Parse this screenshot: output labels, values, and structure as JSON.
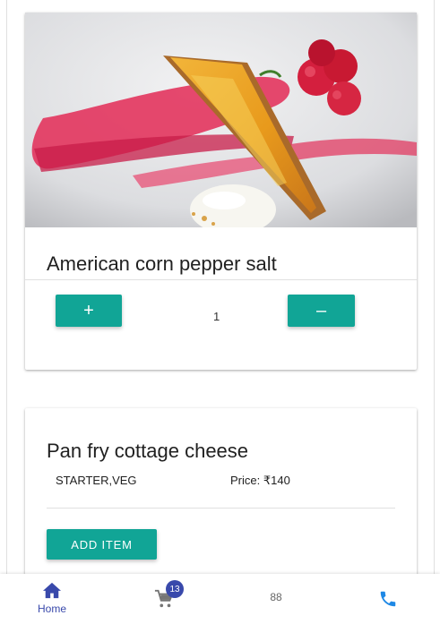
{
  "menu": {
    "items": [
      {
        "name": "American corn pepper salt",
        "image": "creme brulee tart slice with raspberries and cream on a white plate",
        "quantity": "1",
        "increment_label": "+",
        "decrement_label": "–"
      },
      {
        "name": "Pan fry cottage cheese",
        "category": "STARTER,VEG",
        "price": "Price: ₹140",
        "add_label": "ADD ITEM"
      }
    ]
  },
  "bottom_nav": {
    "home_label": "Home",
    "cart_badge": "13",
    "count_value": "88"
  },
  "colors": {
    "accent": "#11a596",
    "nav_active": "#3949ab",
    "phone_icon": "#1e88e5"
  }
}
